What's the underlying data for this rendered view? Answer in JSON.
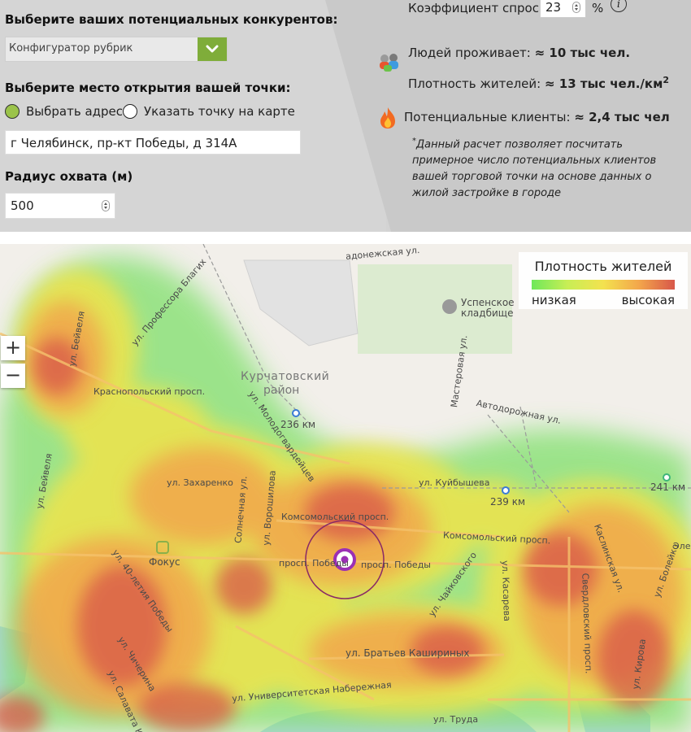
{
  "form": {
    "competitors_label": "Выберите ваших потенциальных конкурентов:",
    "rubric_select_value": "Конфигуратор рубрик",
    "place_label": "Выберите место открытия вашей точки:",
    "radio_address_label": "Выбрать адрес",
    "radio_map_label": "Указать точку на карте",
    "address_value": "г Челябинск, пр-кт Победы, д 314А",
    "radius_label": "Радиус охвата (м)",
    "radius_value": "500"
  },
  "stats": {
    "demand_label": "Коэффициент спроса:",
    "demand_value": "23",
    "demand_unit": "%",
    "info_glyph": "i",
    "residents_label": "Людей проживает:",
    "residents_value": "≈ 10 тыс чел.",
    "density_label": "Плотность жителей:",
    "density_value": "≈ 13 тыс чел./км",
    "density_sup": "2",
    "clients_label": "Потенциальные клиенты:",
    "clients_value": "≈ 2,4 тыс чел",
    "note_star": "*",
    "note_text": "Данный расчет позволяет посчитать примерное число потенциальных клиентов вашей торговой точки на основе данных о жилой застройке в городе"
  },
  "map": {
    "zoom_in": "+",
    "zoom_out": "−",
    "legend_title": "Плотность жителей",
    "legend_low": "низкая",
    "legend_high": "высокая",
    "labels": [
      "Курчатовский",
      "район",
      "Успенское",
      "кладбище",
      "236 км",
      "239 км",
      "241 км",
      "Фокус",
      "Комсомольский просп.",
      "Комсомольский просп.",
      "просп. Победы",
      "просп. Победы",
      "ул. Братьев Кашириных",
      "ул. Университетская Набережная",
      "ул. Труда",
      "Краснопольский просп.",
      "ул. Захаренко",
      "ул. Куйбышева",
      "Автодорожная ул.",
      "Мастеровая ул.",
      "Свердловский просп.",
      "ул. Кирова",
      "ул. Бейвеля",
      "ул. Чичерина",
      "ул. 40-летия Победы",
      "ул. Чайковского",
      "ул. Молодогвардейцев",
      "ул. Профессора Благих",
      "ул. Ворошилова",
      "Солнечная ул.",
      "ул. Касарева",
      "Каслинская ул.",
      "ул. Болейко",
      "ул. Салавата Юлаева",
      "адонежская ул.",
      "ул. Бейвеля",
      "Эле"
    ]
  },
  "colors": {
    "accent_green": "#7fad3a",
    "radio_on": "#9bc34a",
    "marker": "#9b2fb5",
    "heat_low": "#6ee85a",
    "heat_mid": "#f3e24f",
    "heat_high": "#d8574a"
  },
  "icons": [
    "chevron-down-icon",
    "people-icon",
    "fire-icon",
    "info-icon",
    "cemetery-icon",
    "metro-station-icon",
    "location-marker-icon"
  ]
}
